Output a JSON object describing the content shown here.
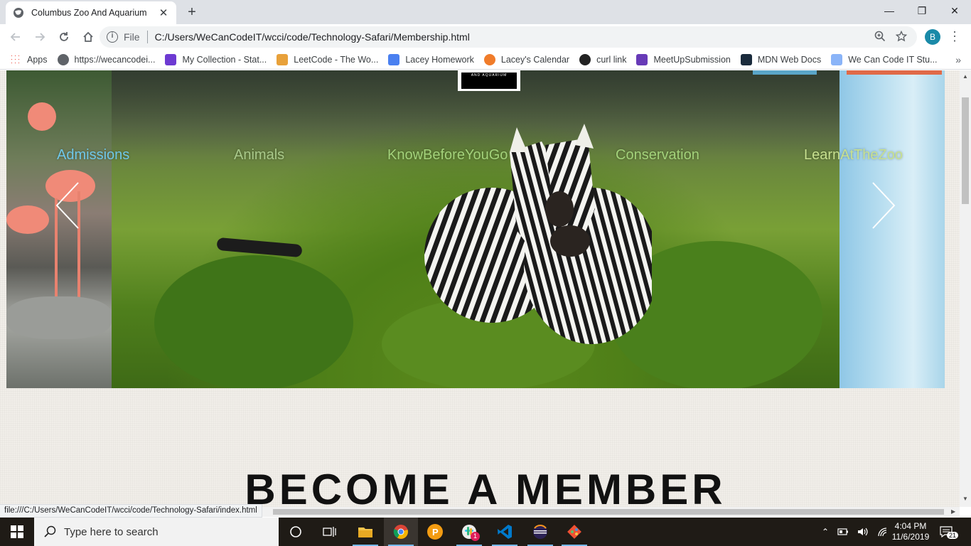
{
  "browser": {
    "tab_title": "Columbus Zoo And Aquarium",
    "tab_close": "✕",
    "new_tab": "+",
    "window_controls": {
      "minimize": "—",
      "maximize": "❐",
      "close": "✕"
    },
    "scheme_label": "File",
    "url": "C:/Users/WeCanCodeIT/wcci/code/Technology-Safari/Membership.html",
    "profile_initial": "B",
    "bookmarks": [
      {
        "label": "Apps",
        "color": "#4285f4"
      },
      {
        "label": "https://wecancodei...",
        "color": "#5f6368"
      },
      {
        "label": "My Collection - Stat...",
        "color": "#6d3ad2"
      },
      {
        "label": "LeetCode - The Wo...",
        "color": "#e8a13a"
      },
      {
        "label": "Lacey Homework",
        "color": "#4a80f0"
      },
      {
        "label": "Lacey's Calendar",
        "color": "#f07c2a"
      },
      {
        "label": "curl link",
        "color": "#222222"
      },
      {
        "label": "MeetUpSubmission",
        "color": "#673ab7"
      },
      {
        "label": "MDN Web Docs",
        "color": "#1a2b3c"
      },
      {
        "label": "We Can Code IT Stu...",
        "color": "#8ab4f8"
      }
    ],
    "bookmarks_more": "»",
    "status_url": "file:///C:/Users/WeCanCodeIT/wcci/code/Technology-Safari/index.html"
  },
  "page": {
    "logo_text": "AND AQUARIUM",
    "nav_links": [
      {
        "label": "Admissions",
        "color": "#6fc7e8"
      },
      {
        "label": "Animals",
        "color": "#a9c98a"
      },
      {
        "label": "KnowBeforeYouGo",
        "color": "#a3d27a"
      },
      {
        "label": "Conservation",
        "color": "#a3d27a"
      },
      {
        "label": "LearnAtTheZoo",
        "color": "#c7e08f"
      }
    ],
    "heading": "BECOME A MEMBER",
    "accent_blue": "#5aa5c8",
    "accent_orange": "#e06a48"
  },
  "taskbar": {
    "search_placeholder": "Type here to search",
    "time": "4:04 PM",
    "date": "11/6/2019",
    "notification_count": "21",
    "app_badge": "1"
  }
}
